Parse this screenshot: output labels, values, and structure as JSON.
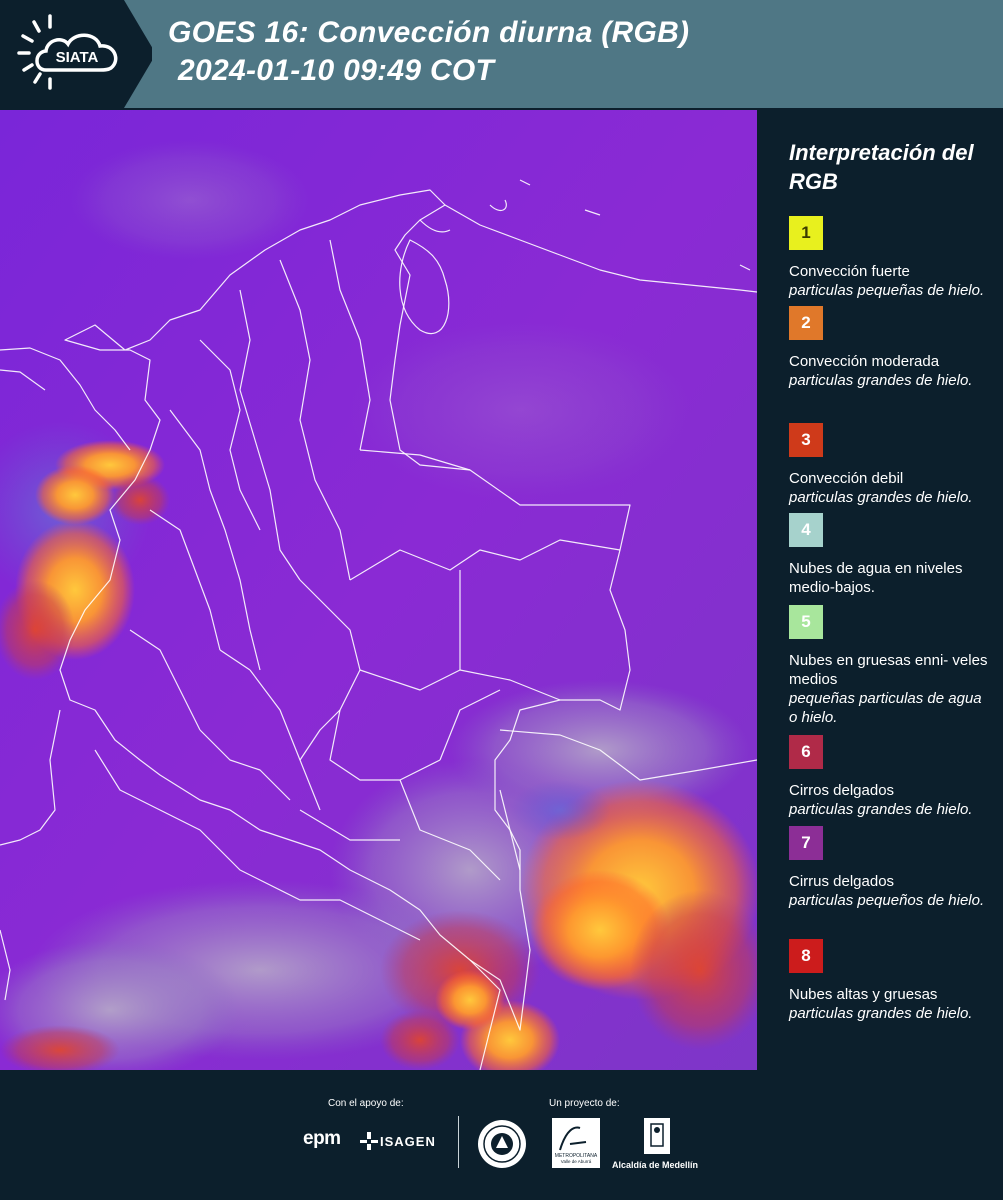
{
  "header": {
    "brand": "SIATA",
    "title_line1": "GOES 16: Convección diurna (RGB)",
    "title_line2": "2024-01-10 09:49 COT"
  },
  "legend": {
    "title": "Interpretación del RGB",
    "items": [
      {
        "number": "1",
        "color": "#e8f01e",
        "text_color": "#3a3a00",
        "main": "Convección fuerte",
        "sub": "particulas pequeñas de hielo."
      },
      {
        "number": "2",
        "color": "#e0782a",
        "text_color": "#ffffff",
        "main": "Convección moderada",
        "sub": "particulas grandes de hielo."
      },
      {
        "number": "3",
        "color": "#cf3a1a",
        "text_color": "#ffffff",
        "main": "Convección debil",
        "sub": "particulas grandes de hielo."
      },
      {
        "number": "4",
        "color": "#a6d2cc",
        "text_color": "#ffffff",
        "main": "Nubes de agua en niveles medio-bajos.",
        "sub": ""
      },
      {
        "number": "5",
        "color": "#a8e69c",
        "text_color": "#ffffff",
        "main": "Nubes en gruesas enni- veles medios",
        "sub": "pequeñas particulas de agua o hielo."
      },
      {
        "number": "6",
        "color": "#b02a48",
        "text_color": "#ffffff",
        "main": "Cirros delgados",
        "sub": "particulas grandes de hielo."
      },
      {
        "number": "7",
        "color": "#8c2e96",
        "text_color": "#ffffff",
        "main": "Cirrus delgados",
        "sub": "particulas pequeños de hielo."
      },
      {
        "number": "8",
        "color": "#cc1c1c",
        "text_color": "#ffffff",
        "main": "Nubes altas y gruesas",
        "sub": "particulas grandes de hielo."
      }
    ]
  },
  "footer": {
    "support_label": "Con el apoyo de:",
    "project_label": "Un proyecto de:",
    "epm": "epm",
    "isagen": "ISAGEN",
    "area_small": "METROPOLITANA",
    "area_sub": "Valle de Aburrá",
    "alcaldia": "Alcaldía de Medellín"
  }
}
